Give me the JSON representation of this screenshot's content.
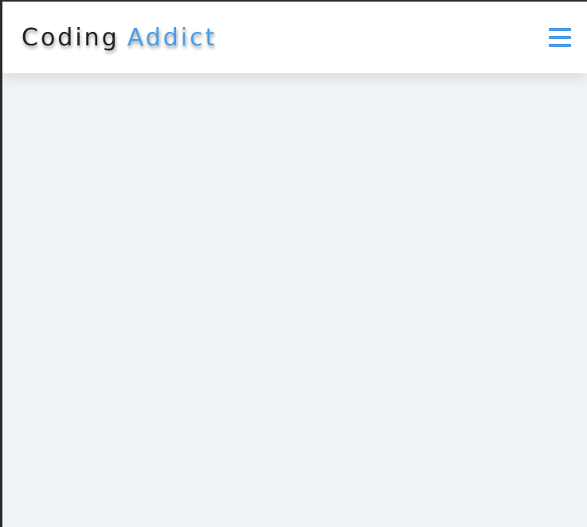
{
  "navbar": {
    "brand": {
      "primary": "Coding",
      "accent": "Addict"
    },
    "menu_icon": "hamburger-menu-icon"
  },
  "colors": {
    "accent": "#4a9de6",
    "text": "#222222",
    "navbar_bg": "#ffffff",
    "page_bg": "#f0f4f7"
  }
}
